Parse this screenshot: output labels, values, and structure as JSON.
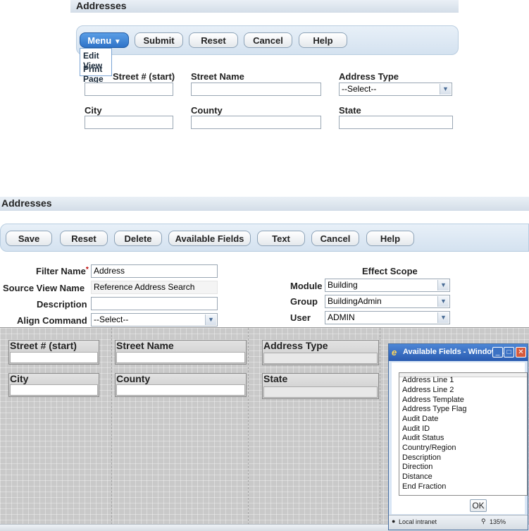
{
  "top_panel": {
    "title": "Addresses",
    "buttons": {
      "menu": "Menu",
      "submit": "Submit",
      "reset": "Reset",
      "cancel": "Cancel",
      "help": "Help"
    },
    "menu_items": [
      "Edit View",
      "Print Page"
    ],
    "labels": {
      "street_num": "Street # (start)",
      "street_name": "Street Name",
      "address_type": "Address Type",
      "city": "City",
      "county": "County",
      "state": "State"
    },
    "address_type_value": "--Select--"
  },
  "bottom_panel": {
    "title": "Addresses",
    "buttons": {
      "save": "Save",
      "reset": "Reset",
      "delete": "Delete",
      "available_fields": "Available Fields",
      "text": "Text",
      "cancel": "Cancel",
      "help": "Help"
    },
    "form": {
      "filter_name_label": "Filter Name",
      "required_mark": "*",
      "filter_name_value": "Address",
      "source_view_label": "Source View Name",
      "source_view_value": "Reference Address Search",
      "description_label": "Description",
      "description_value": "",
      "align_label": "Align Command",
      "align_value": "--Select--",
      "effect_scope_label": "Effect Scope",
      "module_label": "Module",
      "module_value": "Building",
      "group_label": "Group",
      "group_value": "BuildingAdmin",
      "user_label": "User",
      "user_value": "ADMIN"
    },
    "canvas_fields": {
      "street_num": "Street # (start)",
      "street_name": "Street Name",
      "address_type": "Address Type",
      "city": "City",
      "county": "County",
      "state": "State"
    }
  },
  "popup": {
    "title": "Available Fields - Window...",
    "items": [
      "Address Line 1",
      "Address Line 2",
      "Address Template",
      "Address Type Flag",
      "Audit Date",
      "Audit ID",
      "Audit Status",
      "Country/Region",
      "Description",
      "Direction",
      "Distance",
      "End Fraction"
    ],
    "ok_label": "OK",
    "status_zone": "Local intranet",
    "zoom": "135%"
  },
  "colors": {
    "menu_button": "#2e73c8",
    "close_button": "#d65a3c",
    "window_title": "#2a5bb0"
  }
}
